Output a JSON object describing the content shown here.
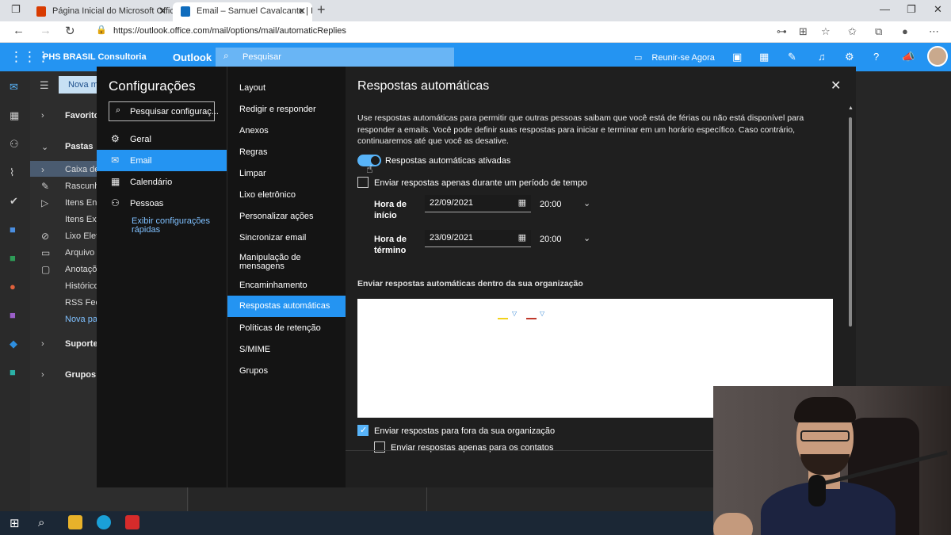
{
  "browser": {
    "tabs": [
      {
        "title": "Página Inicial do Microsoft Office",
        "icon": "office-icon",
        "color": "#d83b01"
      },
      {
        "title": "Email – Samuel Cavalcante | PHS",
        "icon": "outlook-icon",
        "color": "#0f6cbd"
      }
    ],
    "url": "https://outlook.office.com/mail/options/mail/automaticReplies"
  },
  "header": {
    "org": "PHS BRASIL Consultoria",
    "app": "Outlook",
    "search_placeholder": "Pesquisar",
    "meet_now": "Reunir-se Agora",
    "accent": "#2494f2"
  },
  "folders": {
    "new_message": "Nova m",
    "favorites": "Favoritos",
    "folders_header": "Pastas",
    "items": [
      {
        "label": "Caixa de",
        "icon": "inbox-icon"
      },
      {
        "label": "Rascunho",
        "icon": "pencil-icon"
      },
      {
        "label": "Itens Env",
        "icon": "send-icon"
      },
      {
        "label": "Itens Exc",
        "icon": "trash-icon"
      },
      {
        "label": "Lixo Eletr",
        "icon": "block-icon"
      },
      {
        "label": "Arquivo M",
        "icon": "archive-icon"
      },
      {
        "label": "Anotaçõ",
        "icon": "note-icon"
      },
      {
        "label": "Histórico",
        "icon": ""
      },
      {
        "label": "RSS Feed",
        "icon": ""
      },
      {
        "label": "Nova pas",
        "icon": ""
      }
    ],
    "support": "Suporte",
    "groups": "Grupos"
  },
  "settings": {
    "title": "Configurações",
    "search_placeholder": "Pesquisar configuraç...",
    "categories": [
      {
        "label": "Geral",
        "icon": "gear-icon"
      },
      {
        "label": "Email",
        "icon": "mail-icon"
      },
      {
        "label": "Calendário",
        "icon": "calendar-icon"
      },
      {
        "label": "Pessoas",
        "icon": "people-icon"
      }
    ],
    "quick_settings": "Exibir configurações rápidas",
    "subcategories": [
      "Layout",
      "Redigir e responder",
      "Anexos",
      "Regras",
      "Limpar",
      "Lixo eletrônico",
      "Personalizar ações",
      "Sincronizar email",
      "Manipulação de mensagens",
      "Encaminhamento",
      "Respostas automáticas",
      "Políticas de retenção",
      "S/MIME",
      "Grupos"
    ]
  },
  "auto_replies": {
    "title": "Respostas automáticas",
    "description": "Use respostas automáticas para permitir que outras pessoas saibam que você está de férias ou não está disponível para responder a emails. Você pode definir suas respostas para iniciar e terminar em um horário específico. Caso contrário, continuaremos até que você as desative.",
    "toggle_label": "Respostas automáticas ativadas",
    "toggle_on": true,
    "period_label": "Enviar respostas apenas durante um período de tempo",
    "start_label": "Hora de início",
    "start_date": "22/09/2021",
    "start_time": "20:00",
    "end_label": "Hora de término",
    "end_date": "23/09/2021",
    "end_time": "20:00",
    "inside_org_label": "Enviar respostas automáticas dentro da sua organização",
    "outside_label": "Enviar respostas para fora da sua organização",
    "contacts_only_label": "Enviar respostas apenas para os contatos"
  }
}
